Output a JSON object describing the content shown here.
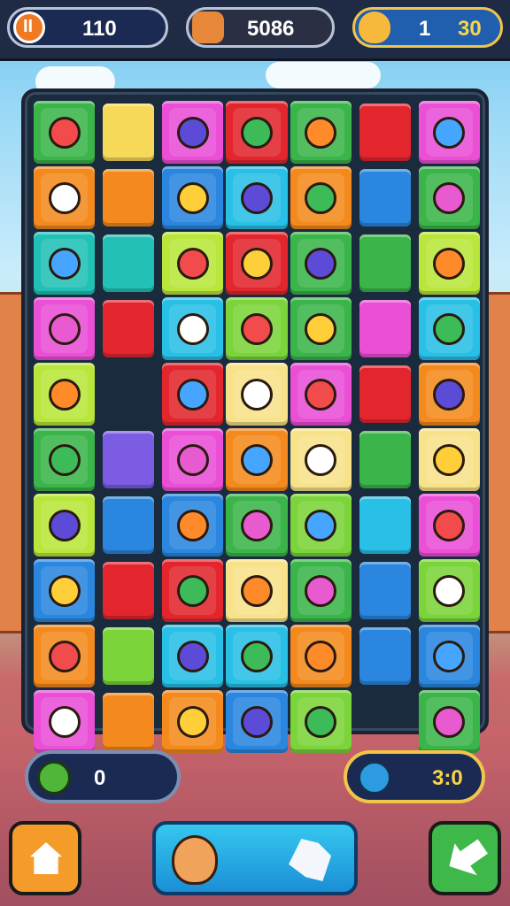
{
  "top_bar": {
    "lives": {
      "icon": "pause-icon",
      "value": "110"
    },
    "coins": {
      "icon": "coin-bag-icon",
      "value": "5086"
    },
    "moves": {
      "icon": "gem-drop-icon",
      "value_left": "1",
      "value_right": "30"
    }
  },
  "board": {
    "rows": [
      [
        {
          "c": "#3bb54a",
          "i": "mask-icon"
        },
        {
          "c": "#f7d95a",
          "i": ""
        },
        {
          "c": "#ea4fd6",
          "i": "lollipop-icon"
        },
        {
          "c": "#e3262e",
          "i": "crayon-icon"
        },
        {
          "c": "#3bb54a",
          "i": "flower-icon"
        },
        {
          "c": "#e3262e",
          "i": ""
        },
        {
          "c": "#ea4fd6",
          "i": "helmet-icon"
        }
      ],
      [
        {
          "c": "#f48a1d",
          "i": "cat-icon"
        },
        {
          "c": "#f48a1d",
          "i": ""
        },
        {
          "c": "#2a86de",
          "i": "flower-bud-icon"
        },
        {
          "c": "#28c0e6",
          "i": "cake-icon"
        },
        {
          "c": "#f48a1d",
          "i": "cookie-icon"
        },
        {
          "c": "#2a86de",
          "i": ""
        },
        {
          "c": "#3bb54a",
          "i": "umbrella-icon"
        }
      ],
      [
        {
          "c": "#22c1b5",
          "i": "heart-icon"
        },
        {
          "c": "#22c1b5",
          "i": ""
        },
        {
          "c": "#b9e63a",
          "i": "candy-wrapper-icon"
        },
        {
          "c": "#e3262e",
          "i": "cake-slice-icon"
        },
        {
          "c": "#3bb54a",
          "i": "orange-icon"
        },
        {
          "c": "#3bb54a",
          "i": ""
        },
        {
          "c": "#b9e63a",
          "i": "cake-icon"
        }
      ],
      [
        {
          "c": "#ea4fd6",
          "i": "lemon-icon"
        },
        {
          "c": "#e3262e",
          "i": ""
        },
        {
          "c": "#28c0e6",
          "i": "gear-candy-icon"
        },
        {
          "c": "#7ad43a",
          "i": "plum-icon"
        },
        {
          "c": "#3bb54a",
          "i": "heart-icon"
        },
        {
          "c": "#ea4fd6",
          "i": ""
        },
        {
          "c": "#28c0e6",
          "i": "leaf-icon"
        }
      ],
      [
        {
          "c": "#b9e63a",
          "i": "lemon-icon"
        },
        {
          "c": "",
          "i": ""
        },
        {
          "c": "#e3262e",
          "i": "crayon-icon"
        },
        {
          "c": "#f7e28a",
          "i": "cake-icon"
        },
        {
          "c": "#ea4fd6",
          "i": "apple-icon"
        },
        {
          "c": "#e3262e",
          "i": ""
        },
        {
          "c": "#f48a1d",
          "i": "cracker-icon"
        }
      ],
      [
        {
          "c": "#3bb54a",
          "i": "flower-icon"
        },
        {
          "c": "#7b5ce3",
          "i": ""
        },
        {
          "c": "#ea4fd6",
          "i": "eraser-icon"
        },
        {
          "c": "#f48a1d",
          "i": "leaf-icon"
        },
        {
          "c": "#f7e28a",
          "i": "block-icon"
        },
        {
          "c": "#3bb54a",
          "i": ""
        },
        {
          "c": "#f7e28a",
          "i": "eraser-icon"
        }
      ],
      [
        {
          "c": "#b9e63a",
          "i": "cake-slice-icon"
        },
        {
          "c": "#2a86de",
          "i": ""
        },
        {
          "c": "#2a86de",
          "i": "heart-icon"
        },
        {
          "c": "#3bb54a",
          "i": "plum-icon"
        },
        {
          "c": "#7ad43a",
          "i": "candy-roll-icon"
        },
        {
          "c": "#28c0e6",
          "i": ""
        },
        {
          "c": "#ea4fd6",
          "i": "cube-icon"
        }
      ],
      [
        {
          "c": "#2a86de",
          "i": "heart-icon"
        },
        {
          "c": "#e3262e",
          "i": ""
        },
        {
          "c": "#e3262e",
          "i": "candy-bar-icon"
        },
        {
          "c": "#f7e28a",
          "i": "lemon-icon"
        },
        {
          "c": "#3bb54a",
          "i": "umbrella-icon"
        },
        {
          "c": "#2a86de",
          "i": ""
        },
        {
          "c": "#7ad43a",
          "i": "lemon-icon"
        }
      ],
      [
        {
          "c": "#f48a1d",
          "i": "bandage-icon"
        },
        {
          "c": "#7ad43a",
          "i": ""
        },
        {
          "c": "#28c0e6",
          "i": "ball-icon"
        },
        {
          "c": "#28c0e6",
          "i": "grape-icon"
        },
        {
          "c": "#f48a1d",
          "i": "apple-icon"
        },
        {
          "c": "#2a86de",
          "i": ""
        },
        {
          "c": "#2a86de",
          "i": "box-icon"
        }
      ],
      [
        {
          "c": "#ea4fd6",
          "i": "apple-icon"
        },
        {
          "c": "#f48a1d",
          "i": ""
        },
        {
          "c": "#f48a1d",
          "i": "ball-icon"
        },
        {
          "c": "#2a86de",
          "i": "strawberry-icon"
        },
        {
          "c": "#7ad43a",
          "i": "star-icon"
        },
        {
          "c": "",
          "i": ""
        },
        {
          "c": "#3bb54a",
          "i": "sweet-potato-icon"
        }
      ]
    ]
  },
  "bottom": {
    "left_counter": {
      "icon": "apple-icon",
      "value": "0"
    },
    "right_counter": {
      "icon": "potion-icon",
      "value": "3:0"
    },
    "home_button": {
      "icon": "home-icon"
    },
    "center_button": {
      "icons": [
        "character-icon",
        "candy-icon"
      ]
    },
    "next_button": {
      "icon": "arrow-icon"
    }
  }
}
